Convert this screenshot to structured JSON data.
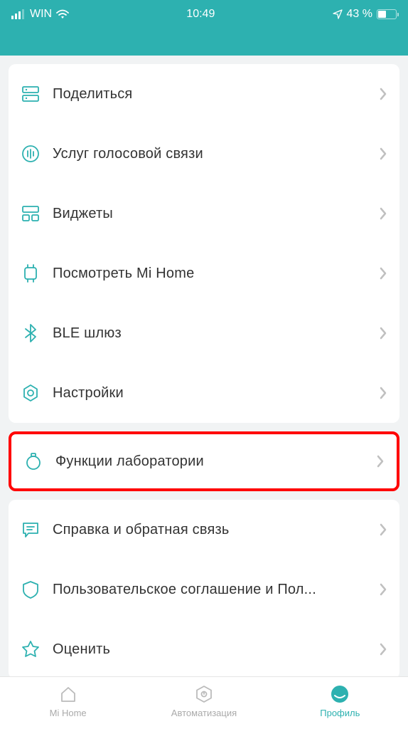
{
  "statusbar": {
    "carrier": "WIN",
    "time": "10:49",
    "battery": "43 %"
  },
  "groups": [
    {
      "highlight": false,
      "items": [
        {
          "id": "share",
          "icon": "share",
          "label": "Поделиться"
        },
        {
          "id": "voice",
          "icon": "voice",
          "label": "Услуг голосовой связи"
        },
        {
          "id": "widgets",
          "icon": "widgets",
          "label": "Виджеты"
        },
        {
          "id": "watch",
          "icon": "watch",
          "label": "Посмотреть Mi Home"
        },
        {
          "id": "ble",
          "icon": "ble",
          "label": "BLE шлюз"
        },
        {
          "id": "settings",
          "icon": "settings",
          "label": "Настройки"
        }
      ]
    },
    {
      "highlight": true,
      "items": [
        {
          "id": "lab",
          "icon": "lab",
          "label": "Функции лаборатории"
        }
      ]
    },
    {
      "highlight": false,
      "items": [
        {
          "id": "help",
          "icon": "help",
          "label": "Справка и обратная связь"
        },
        {
          "id": "legal",
          "icon": "legal",
          "label": "Пользовательское соглашение и Пол..."
        },
        {
          "id": "rate",
          "icon": "rate",
          "label": "Оценить"
        }
      ]
    }
  ],
  "tabs": [
    {
      "id": "home",
      "label": "Mi Home",
      "active": false
    },
    {
      "id": "automation",
      "label": "Автоматизация",
      "active": false
    },
    {
      "id": "profile",
      "label": "Профиль",
      "active": true
    }
  ]
}
